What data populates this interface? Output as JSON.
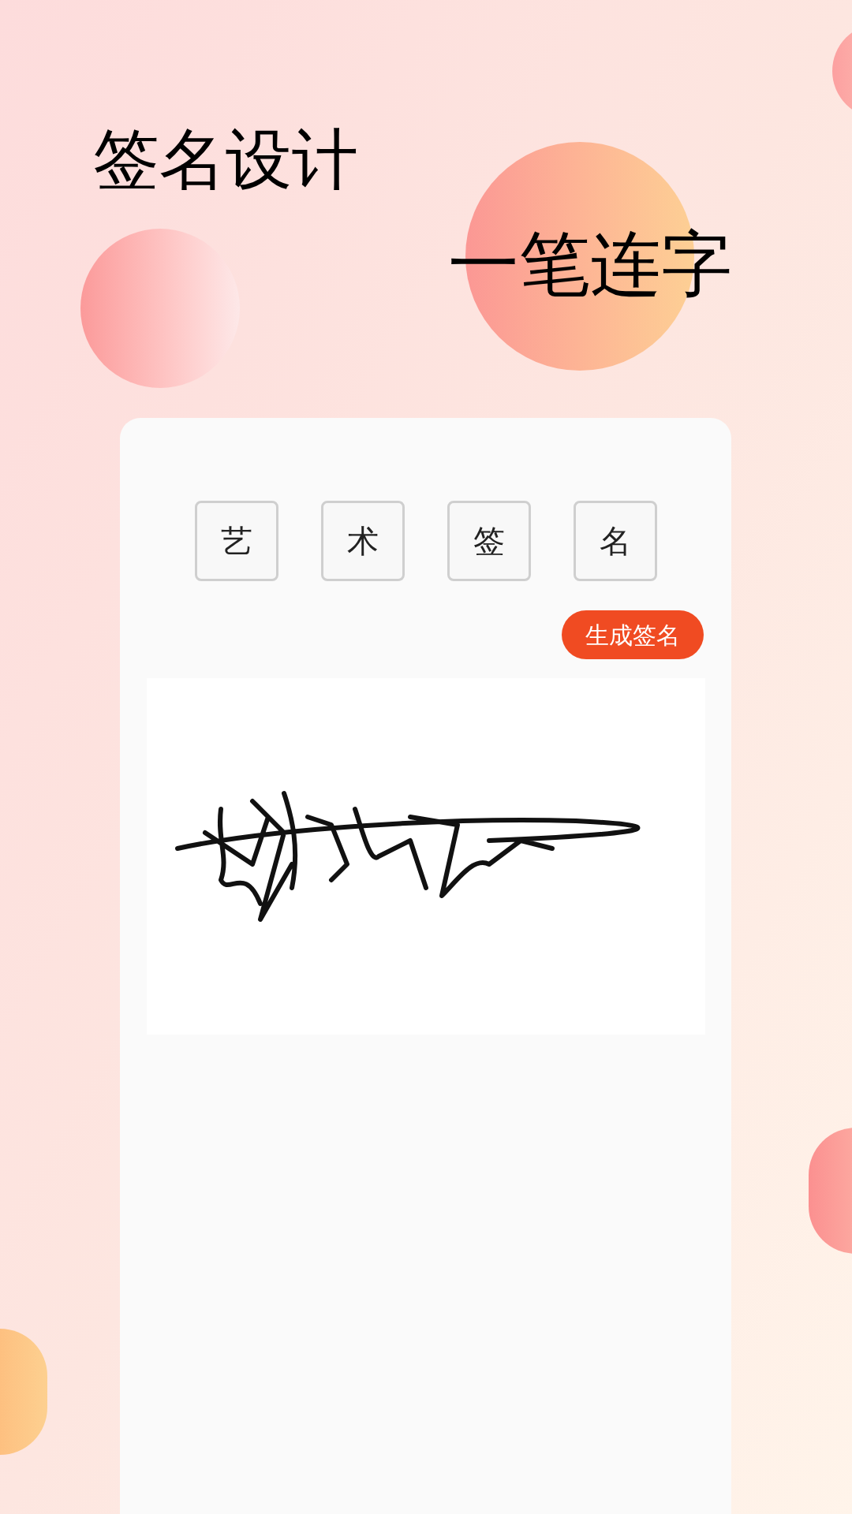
{
  "title": "签名设计",
  "subtitle": "一笔连字",
  "characters": [
    "艺",
    "术",
    "签",
    "名"
  ],
  "generate_button": "生成签名"
}
